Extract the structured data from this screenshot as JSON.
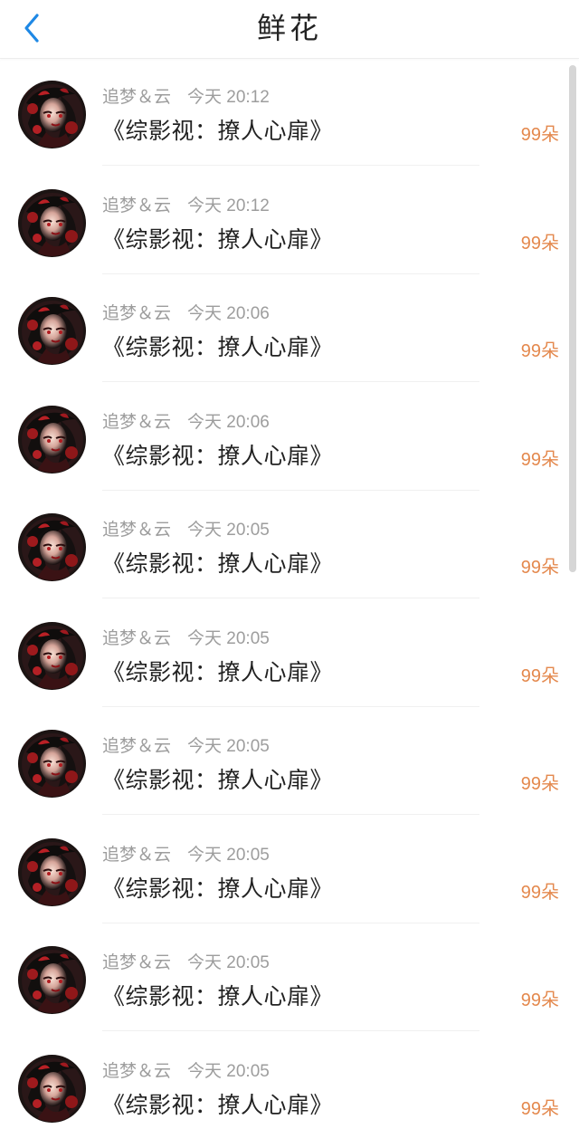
{
  "header": {
    "title": "鲜花",
    "back_icon": "chevron-left-icon"
  },
  "gifts": [
    {
      "user": "追梦＆云",
      "time": "今天 20:12",
      "book": "《综影视：撩人心扉》",
      "amount": "99朵"
    },
    {
      "user": "追梦＆云",
      "time": "今天 20:12",
      "book": "《综影视：撩人心扉》",
      "amount": "99朵"
    },
    {
      "user": "追梦＆云",
      "time": "今天 20:06",
      "book": "《综影视：撩人心扉》",
      "amount": "99朵"
    },
    {
      "user": "追梦＆云",
      "time": "今天 20:06",
      "book": "《综影视：撩人心扉》",
      "amount": "99朵"
    },
    {
      "user": "追梦＆云",
      "time": "今天 20:05",
      "book": "《综影视：撩人心扉》",
      "amount": "99朵"
    },
    {
      "user": "追梦＆云",
      "time": "今天 20:05",
      "book": "《综影视：撩人心扉》",
      "amount": "99朵"
    },
    {
      "user": "追梦＆云",
      "time": "今天 20:05",
      "book": "《综影视：撩人心扉》",
      "amount": "99朵"
    },
    {
      "user": "追梦＆云",
      "time": "今天 20:05",
      "book": "《综影视：撩人心扉》",
      "amount": "99朵"
    },
    {
      "user": "追梦＆云",
      "time": "今天 20:05",
      "book": "《综影视：撩人心扉》",
      "amount": "99朵"
    },
    {
      "user": "追梦＆云",
      "time": "今天 20:05",
      "book": "《综影视：撩人心扉》",
      "amount": "99朵"
    }
  ],
  "colors": {
    "accent": "#1e88e5",
    "amount": "#e4894e",
    "muted_text": "#9d9d9d",
    "primary_text": "#222222"
  }
}
